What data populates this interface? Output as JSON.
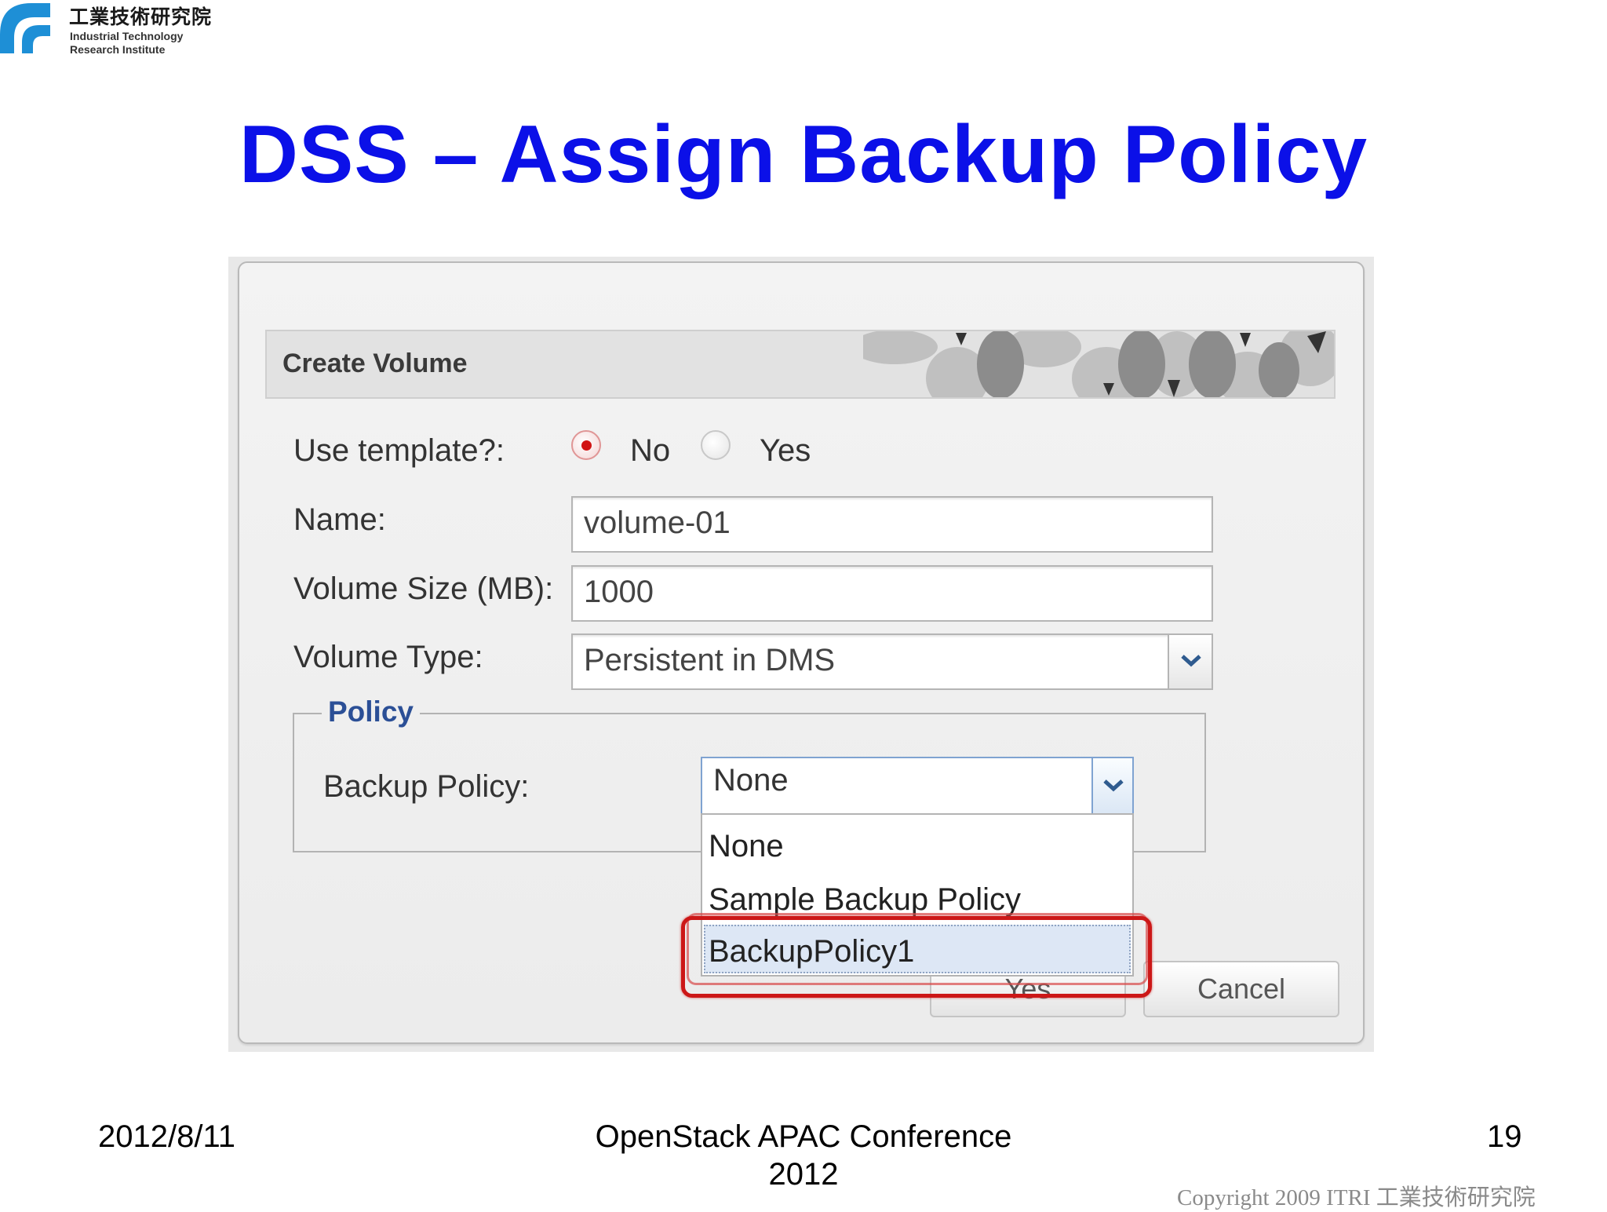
{
  "logo": {
    "name_zh": "工業技術研究院",
    "name_en_line1": "Industrial Technology",
    "name_en_line2": "Research Institute"
  },
  "slide": {
    "title": "DSS – Assign Backup Policy",
    "date": "2012/8/11",
    "conference_line1": "OpenStack APAC Conference",
    "conference_line2": "2012",
    "page_number": "19",
    "copyright": "Copyright 2009 ITRI  工業技術研究院"
  },
  "dialog": {
    "title": "Create Volume",
    "template_label": "Use template?:",
    "template_options": [
      "No",
      "Yes"
    ],
    "template_selected": "No",
    "name_label": "Name:",
    "name_value": "volume-01",
    "size_label": "Volume Size (MB):",
    "size_value": "1000",
    "type_label": "Volume Type:",
    "type_value": "Persistent in DMS",
    "policy_legend": "Policy",
    "backup_label": "Backup Policy:",
    "backup_value": "None",
    "backup_options": [
      "None",
      "Sample Backup Policy",
      "BackupPolicy1"
    ],
    "backup_highlighted": "BackupPolicy1",
    "yes_button": "Yes",
    "cancel_button": "Cancel"
  },
  "colors": {
    "title": "#0b10e8",
    "highlight": "#cc1717",
    "legend": "#2b4f96",
    "logo": "#1e8fd6"
  },
  "icons": {
    "logo": "itri-logo-icon",
    "dropdown": "chevron-down-icon",
    "radio": "radio-icon"
  }
}
